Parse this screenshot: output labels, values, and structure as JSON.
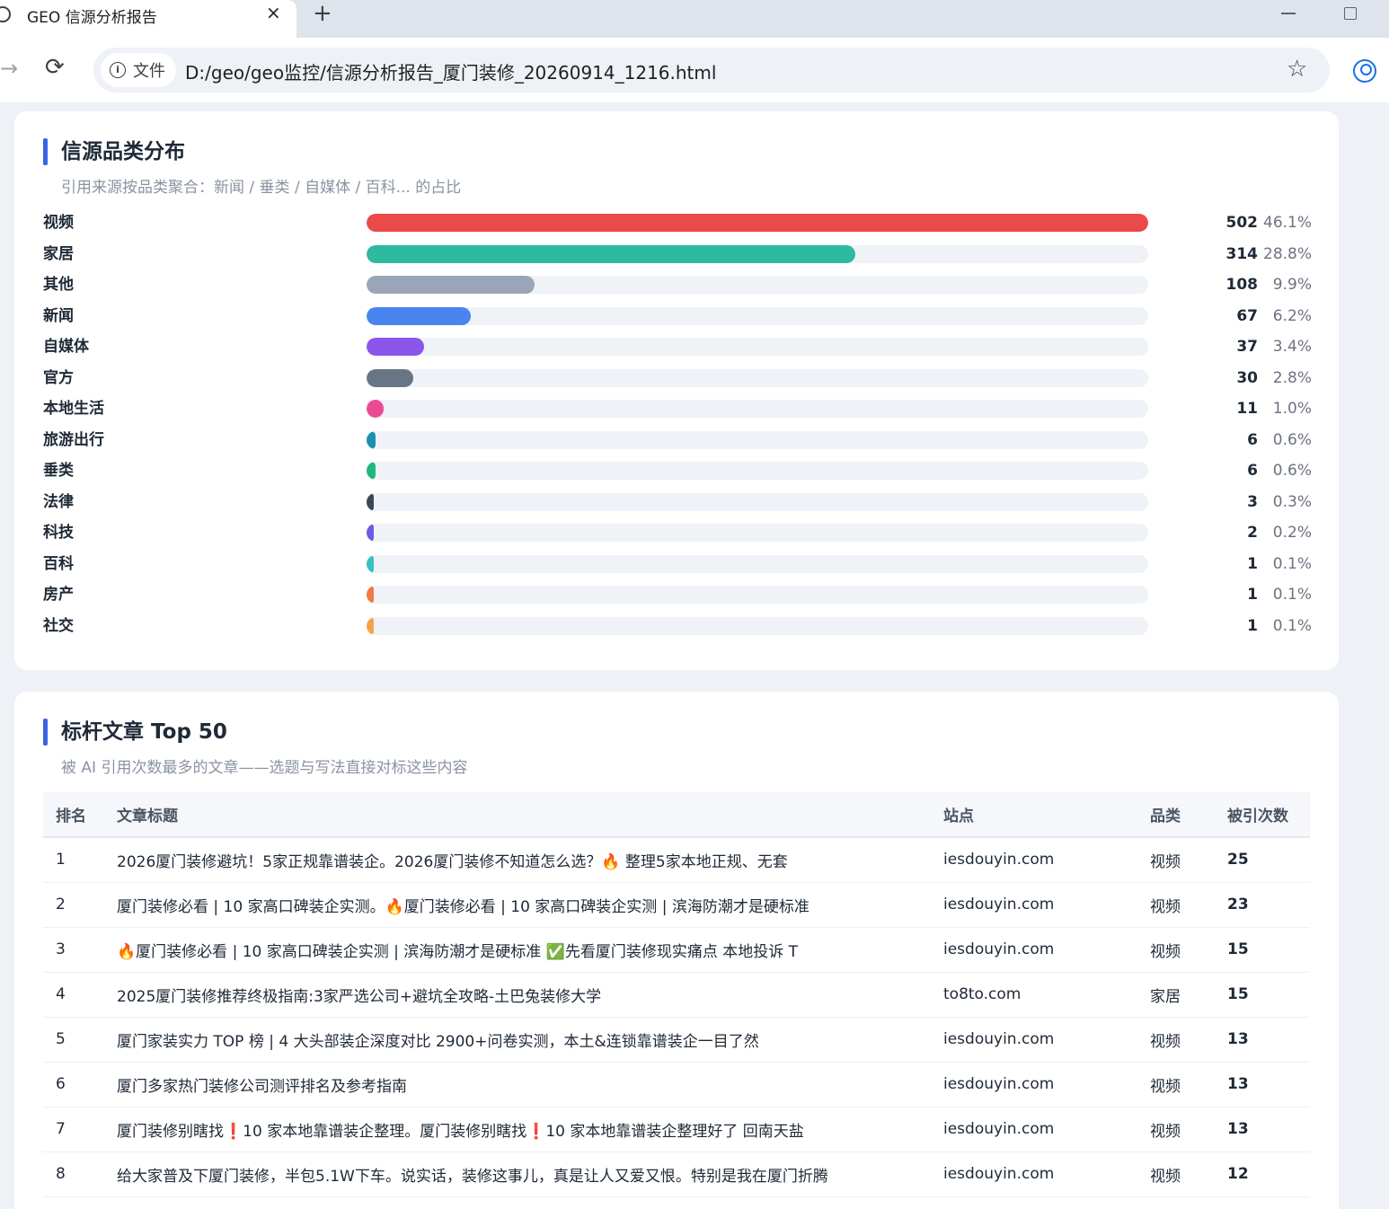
{
  "browser": {
    "tab_title": "GEO 信源分析报告",
    "tab_close": "×",
    "new_tab": "+",
    "site_chip": "文件",
    "url": "D:/geo/geo监控/信源分析报告_厦门装修_20260914_1216.html"
  },
  "category_section": {
    "title": "信源品类分布",
    "subtitle": "引用来源按品类聚合：新闻 / 垂类 / 自媒体 / 百科... 的占比",
    "chart_data": {
      "type": "bar",
      "orientation": "horizontal",
      "max": 502,
      "items": [
        {
          "label": "视频",
          "count": 502,
          "percent": "46.1%",
          "color": "#ea4a4a"
        },
        {
          "label": "家居",
          "count": 314,
          "percent": "28.8%",
          "color": "#2ebaa0"
        },
        {
          "label": "其他",
          "count": 108,
          "percent": "9.9%",
          "color": "#9aa6b8"
        },
        {
          "label": "新闻",
          "count": 67,
          "percent": "6.2%",
          "color": "#4a84f0"
        },
        {
          "label": "自媒体",
          "count": 37,
          "percent": "3.4%",
          "color": "#8b55ec"
        },
        {
          "label": "官方",
          "count": 30,
          "percent": "2.8%",
          "color": "#687587"
        },
        {
          "label": "本地生活",
          "count": 11,
          "percent": "1.0%",
          "color": "#ec4a94"
        },
        {
          "label": "旅游出行",
          "count": 6,
          "percent": "0.6%",
          "color": "#1c91ad"
        },
        {
          "label": "垂类",
          "count": 6,
          "percent": "0.6%",
          "color": "#22b77e"
        },
        {
          "label": "法律",
          "count": 3,
          "percent": "0.3%",
          "color": "#3d4657"
        },
        {
          "label": "科技",
          "count": 2,
          "percent": "0.2%",
          "color": "#6b5ce6"
        },
        {
          "label": "百科",
          "count": 1,
          "percent": "0.1%",
          "color": "#3cc0c0"
        },
        {
          "label": "房产",
          "count": 1,
          "percent": "0.1%",
          "color": "#f07a45"
        },
        {
          "label": "社交",
          "count": 1,
          "percent": "0.1%",
          "color": "#f5a34a"
        }
      ]
    }
  },
  "top_articles": {
    "title": "标杆文章 Top 50",
    "subtitle": "被 AI 引用次数最多的文章——选题与写法直接对标这些内容",
    "columns": [
      "排名",
      "文章标题",
      "站点",
      "品类",
      "被引次数"
    ],
    "rows": [
      {
        "rank": "1",
        "title": "2026厦门装修避坑！5家正规靠谱装企。2026厦门装修不知道怎么选？🔥 整理5家本地正规、无套",
        "site": "iesdouyin.com",
        "category": "视频",
        "cites": "25"
      },
      {
        "rank": "2",
        "title": "厦门装修必看 | 10 家高口碑装企实测。🔥厦门装修必看 | 10 家高口碑装企实测 | 滨海防潮才是硬标准",
        "site": "iesdouyin.com",
        "category": "视频",
        "cites": "23"
      },
      {
        "rank": "3",
        "title": "🔥厦门装修必看 | 10 家高口碑装企实测 | 滨海防潮才是硬标准 ✅先看厦门装修现实痛点 本地投诉 T",
        "site": "iesdouyin.com",
        "category": "视频",
        "cites": "15"
      },
      {
        "rank": "4",
        "title": "2025厦门装修推荐终极指南:3家严选公司+避坑全攻略-土巴兔装修大学",
        "site": "to8to.com",
        "category": "家居",
        "cites": "15"
      },
      {
        "rank": "5",
        "title": "厦门家装实力 TOP 榜 | 4 大头部装企深度对比 2900+问卷实测，本土&连锁靠谱装企一目了然",
        "site": "iesdouyin.com",
        "category": "视频",
        "cites": "13"
      },
      {
        "rank": "6",
        "title": "厦门多家热门装修公司测评排名及参考指南",
        "site": "iesdouyin.com",
        "category": "视频",
        "cites": "13"
      },
      {
        "rank": "7",
        "title": "厦门装修别瞎找❗10 家本地靠谱装企整理。厦门装修别瞎找❗10 家本地靠谱装企整理好了 回南天盐",
        "site": "iesdouyin.com",
        "category": "视频",
        "cites": "13"
      },
      {
        "rank": "8",
        "title": "给大家普及下厦门装修，半包5.1W下车。说实话，装修这事儿，真是让人又爱又恨。特别是我在厦门折腾",
        "site": "iesdouyin.com",
        "category": "视频",
        "cites": "12"
      }
    ]
  }
}
